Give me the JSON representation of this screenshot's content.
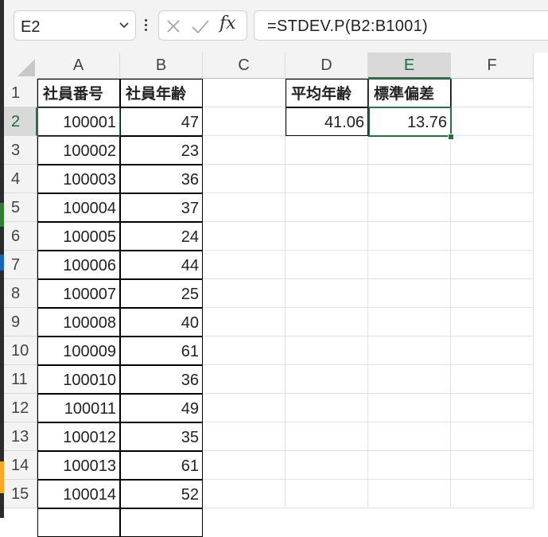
{
  "name_box": {
    "value": "E2"
  },
  "formula": {
    "text": "=STDEV.P(B2:B1001)",
    "fx_label": "fx"
  },
  "columns": [
    "A",
    "B",
    "C",
    "D",
    "E",
    "F"
  ],
  "rows": [
    "1",
    "2",
    "3",
    "4",
    "5",
    "6",
    "7",
    "8",
    "9",
    "10",
    "11",
    "12",
    "13",
    "14",
    "15"
  ],
  "headers": {
    "A1": "社員番号",
    "B1": "社員年齢",
    "D1": "平均年齢",
    "E1": "標準偏差"
  },
  "summary": {
    "D2": "41.06",
    "E2": "13.76"
  },
  "employees": [
    {
      "id": "100001",
      "age": "47"
    },
    {
      "id": "100002",
      "age": "23"
    },
    {
      "id": "100003",
      "age": "36"
    },
    {
      "id": "100004",
      "age": "37"
    },
    {
      "id": "100005",
      "age": "24"
    },
    {
      "id": "100006",
      "age": "44"
    },
    {
      "id": "100007",
      "age": "25"
    },
    {
      "id": "100008",
      "age": "40"
    },
    {
      "id": "100009",
      "age": "61"
    },
    {
      "id": "100010",
      "age": "36"
    },
    {
      "id": "100011",
      "age": "49"
    },
    {
      "id": "100012",
      "age": "35"
    },
    {
      "id": "100013",
      "age": "61"
    },
    {
      "id": "100014",
      "age": "52"
    }
  ],
  "colors": {
    "accent": "#217346",
    "header_bg": "#f3f3f3",
    "selected_header_bg": "#d9d9d9"
  }
}
